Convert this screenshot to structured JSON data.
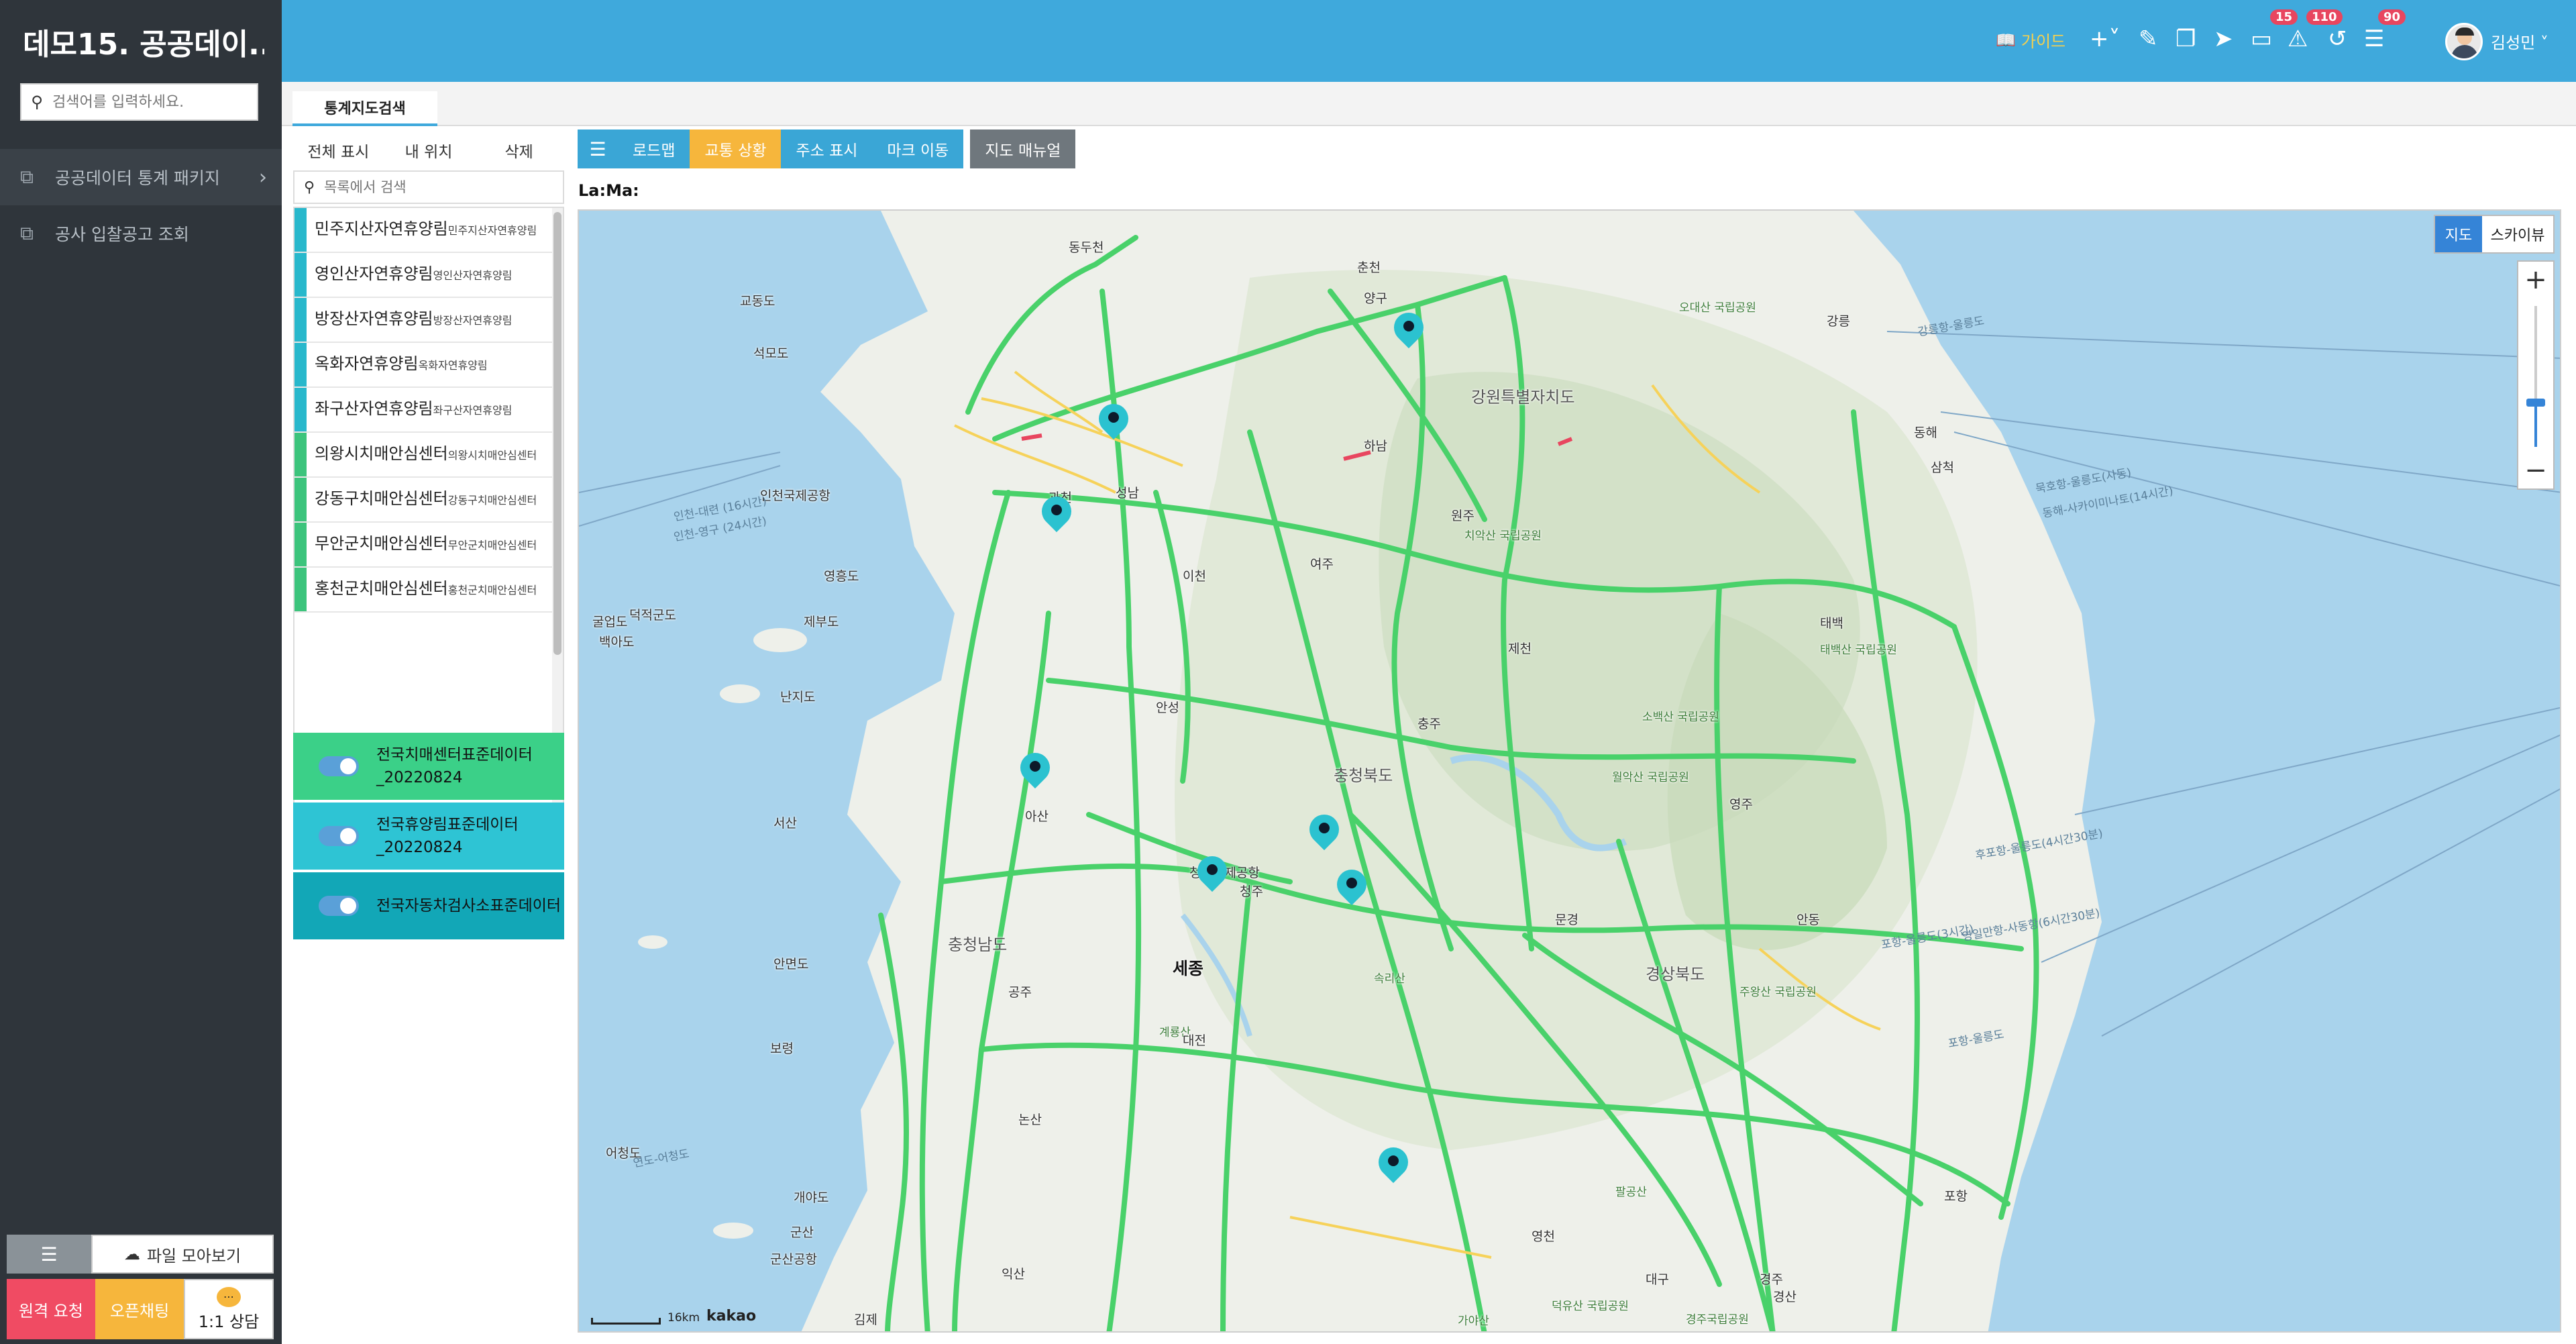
{
  "sidebar": {
    "brand": "데모15. 공공데이...",
    "search_placeholder": "검색어를 입력하세요.",
    "menu": [
      {
        "label": "공공데이터 통계 패키지",
        "icon": "cube-icon"
      },
      {
        "label": "공사 입찰공고 조회",
        "icon": "cube-icon"
      }
    ],
    "file_button": "파일 모아보기",
    "remote_button": "원격 요청",
    "chat_button": "오픈채팅",
    "consult_button": "1:1 상담"
  },
  "topbar": {
    "guide_label": "가이드",
    "badges": {
      "inbox": "15",
      "notifications": "110",
      "list": "90"
    },
    "username": "김성민"
  },
  "tab": {
    "label": "통계지도검색"
  },
  "left_panel": {
    "tabs": [
      "전체 표시",
      "내 위치",
      "삭제"
    ],
    "search_placeholder": "목록에서 검색",
    "items": [
      {
        "name": "민주지산자연휴양림",
        "sub": "민주지산자연휴양림",
        "color": "#28b8cc"
      },
      {
        "name": "영인산자연휴양림",
        "sub": "영인산자연휴양림",
        "color": "#28b8cc"
      },
      {
        "name": "방장산자연휴양림",
        "sub": "방장산자연휴양림",
        "color": "#28b8cc"
      },
      {
        "name": "옥화자연휴양림",
        "sub": "옥화자연휴양림",
        "color": "#28b8cc"
      },
      {
        "name": "좌구산자연휴양림",
        "sub": "좌구산자연휴양림",
        "color": "#28b8cc"
      },
      {
        "name": "의왕시치매안심센터",
        "sub": "의왕시치매안심센터",
        "color": "#3cc47c"
      },
      {
        "name": "강동구치매안심센터",
        "sub": "강동구치매안심센터",
        "color": "#3cc47c"
      },
      {
        "name": "무안군치매안심센터",
        "sub": "무안군치매안심센터",
        "color": "#3cc47c"
      },
      {
        "name": "홍천군치매안심센터",
        "sub": "홍천군치매안심센터",
        "color": "#3cc47c"
      }
    ],
    "layers": [
      {
        "name": "전국치매센터표준데이터_20220824",
        "color": "#3bd088",
        "enabled": true
      },
      {
        "name": "전국휴양림표준데이터_20220824",
        "color": "#2ec4d4",
        "enabled": true
      },
      {
        "name": "전국자동차검사소표준데이터",
        "color": "#12a7b7",
        "enabled": true
      }
    ]
  },
  "map_toolbar": {
    "buttons": [
      "로드맵",
      "교통 상황",
      "주소 표시",
      "마크 이동"
    ],
    "manual": "지도 매뉴얼"
  },
  "coord_label": "La:Ma:",
  "map": {
    "type_buttons": [
      "지도",
      "스카이뷰"
    ],
    "scale": "16km",
    "logo": "kakao",
    "labels": [
      {
        "t": "동두천",
        "c": ""
      },
      {
        "t": "춘천",
        "c": ""
      },
      {
        "t": "양구",
        "c": ""
      },
      {
        "t": "교동도",
        "c": ""
      },
      {
        "t": "석모도",
        "c": ""
      },
      {
        "t": "강릉",
        "c": ""
      },
      {
        "t": "오대산 국립공원",
        "c": "park"
      },
      {
        "t": "강원특별자치도",
        "c": "big"
      },
      {
        "t": "강릉항-울릉도",
        "c": "sea"
      },
      {
        "t": "하남",
        "c": ""
      },
      {
        "t": "동해",
        "c": ""
      },
      {
        "t": "삼척",
        "c": ""
      },
      {
        "t": "묵호항-울릉도(사동)",
        "c": "sea"
      },
      {
        "t": "동해-사카이미나토(14시간)",
        "c": "sea"
      },
      {
        "t": "인천국제공항",
        "c": ""
      },
      {
        "t": "인천-대련 (16시간)",
        "c": "sea"
      },
      {
        "t": "인천-영구 (24시간)",
        "c": "sea"
      },
      {
        "t": "과천",
        "c": ""
      },
      {
        "t": "성남",
        "c": ""
      },
      {
        "t": "원주",
        "c": ""
      },
      {
        "t": "치악산 국립공원",
        "c": "park"
      },
      {
        "t": "영흥도",
        "c": ""
      },
      {
        "t": "이천",
        "c": ""
      },
      {
        "t": "여주",
        "c": ""
      },
      {
        "t": "제천",
        "c": ""
      },
      {
        "t": "태백",
        "c": ""
      },
      {
        "t": "태백산 국립공원",
        "c": "park"
      },
      {
        "t": "덕적군도",
        "c": ""
      },
      {
        "t": "굴업도",
        "c": ""
      },
      {
        "t": "백아도",
        "c": ""
      },
      {
        "t": "제부도",
        "c": ""
      },
      {
        "t": "난지도",
        "c": ""
      },
      {
        "t": "안성",
        "c": ""
      },
      {
        "t": "충주",
        "c": ""
      },
      {
        "t": "소백산 국립공원",
        "c": "park"
      },
      {
        "t": "충청북도",
        "c": "big"
      },
      {
        "t": "월악산 국립공원",
        "c": "park"
      },
      {
        "t": "영주",
        "c": ""
      },
      {
        "t": "서산",
        "c": ""
      },
      {
        "t": "아산",
        "c": ""
      },
      {
        "t": "청주국제공항",
        "c": ""
      },
      {
        "t": "청주",
        "c": ""
      },
      {
        "t": "충청남도",
        "c": "big"
      },
      {
        "t": "문경",
        "c": ""
      },
      {
        "t": "안동",
        "c": ""
      },
      {
        "t": "세종",
        "c": "bold"
      },
      {
        "t": "속리산",
        "c": "park"
      },
      {
        "t": "안면도",
        "c": ""
      },
      {
        "t": "공주",
        "c": ""
      },
      {
        "t": "경상북도",
        "c": "big"
      },
      {
        "t": "주왕산 국립공원",
        "c": "park"
      },
      {
        "t": "보령",
        "c": ""
      },
      {
        "t": "계룡산",
        "c": "park"
      },
      {
        "t": "대전",
        "c": ""
      },
      {
        "t": "논산",
        "c": ""
      },
      {
        "t": "어청도",
        "c": ""
      },
      {
        "t": "연도-어청도",
        "c": "sea"
      },
      {
        "t": "개야도",
        "c": ""
      },
      {
        "t": "포항",
        "c": ""
      },
      {
        "t": "군산",
        "c": ""
      },
      {
        "t": "군산공항",
        "c": ""
      },
      {
        "t": "익산",
        "c": ""
      },
      {
        "t": "팔공산",
        "c": "park"
      },
      {
        "t": "대구",
        "c": ""
      },
      {
        "t": "경주",
        "c": ""
      },
      {
        "t": "김제",
        "c": ""
      },
      {
        "t": "덕유산 국립공원",
        "c": "park"
      },
      {
        "t": "가야산",
        "c": "park"
      },
      {
        "t": "경산",
        "c": ""
      },
      {
        "t": "경주국립공원",
        "c": "park"
      },
      {
        "t": "영천",
        "c": ""
      },
      {
        "t": "후포항-울릉도(4시간30분)",
        "c": "sea"
      },
      {
        "t": "포항-울릉도(3시간)",
        "c": "sea"
      },
      {
        "t": "영일만항-사동항(6시간30분)",
        "c": "sea"
      },
      {
        "t": "포항-울릉도",
        "c": "sea"
      }
    ]
  }
}
